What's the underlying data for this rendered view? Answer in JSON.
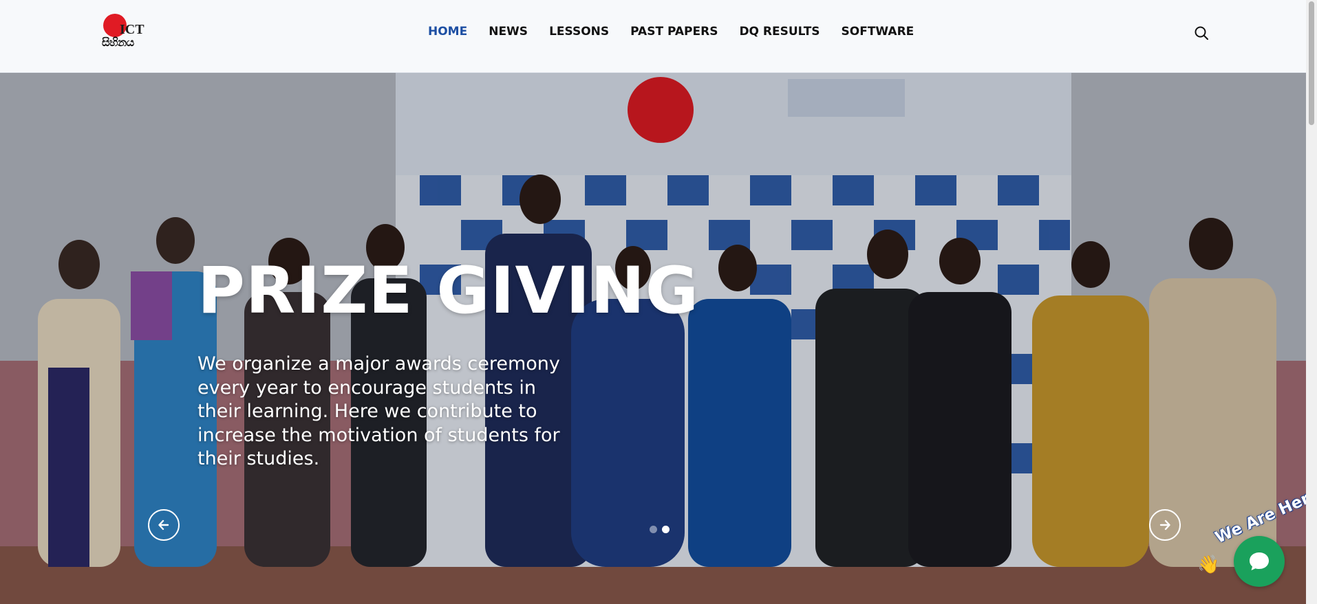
{
  "header": {
    "logo": {
      "badge": "ICT",
      "subtitle": "සිහිනය"
    },
    "nav": [
      {
        "label": "HOME",
        "active": true
      },
      {
        "label": "NEWS",
        "active": false
      },
      {
        "label": "LESSONS",
        "active": false
      },
      {
        "label": "PAST PAPERS",
        "active": false
      },
      {
        "label": "DQ RESULTS",
        "active": false
      },
      {
        "label": "SOFTWARE",
        "active": false
      }
    ],
    "search_icon": "search-icon"
  },
  "hero": {
    "title": "PRIZE GIVING",
    "description": "We organize a major awards ceremony every year to encourage students in their learning. Here we contribute to increase the motivation of students for their studies.",
    "prev_icon": "arrow-left-icon",
    "next_icon": "arrow-right-icon",
    "slides_total": 2,
    "active_slide": 2
  },
  "chat_widget": {
    "label": "We Are Here!",
    "icon": "chat-bubble-icon"
  },
  "colors": {
    "nav_active": "#1d4fa3",
    "brand_red": "#e01b24",
    "chat_green": "#1aa15c"
  }
}
